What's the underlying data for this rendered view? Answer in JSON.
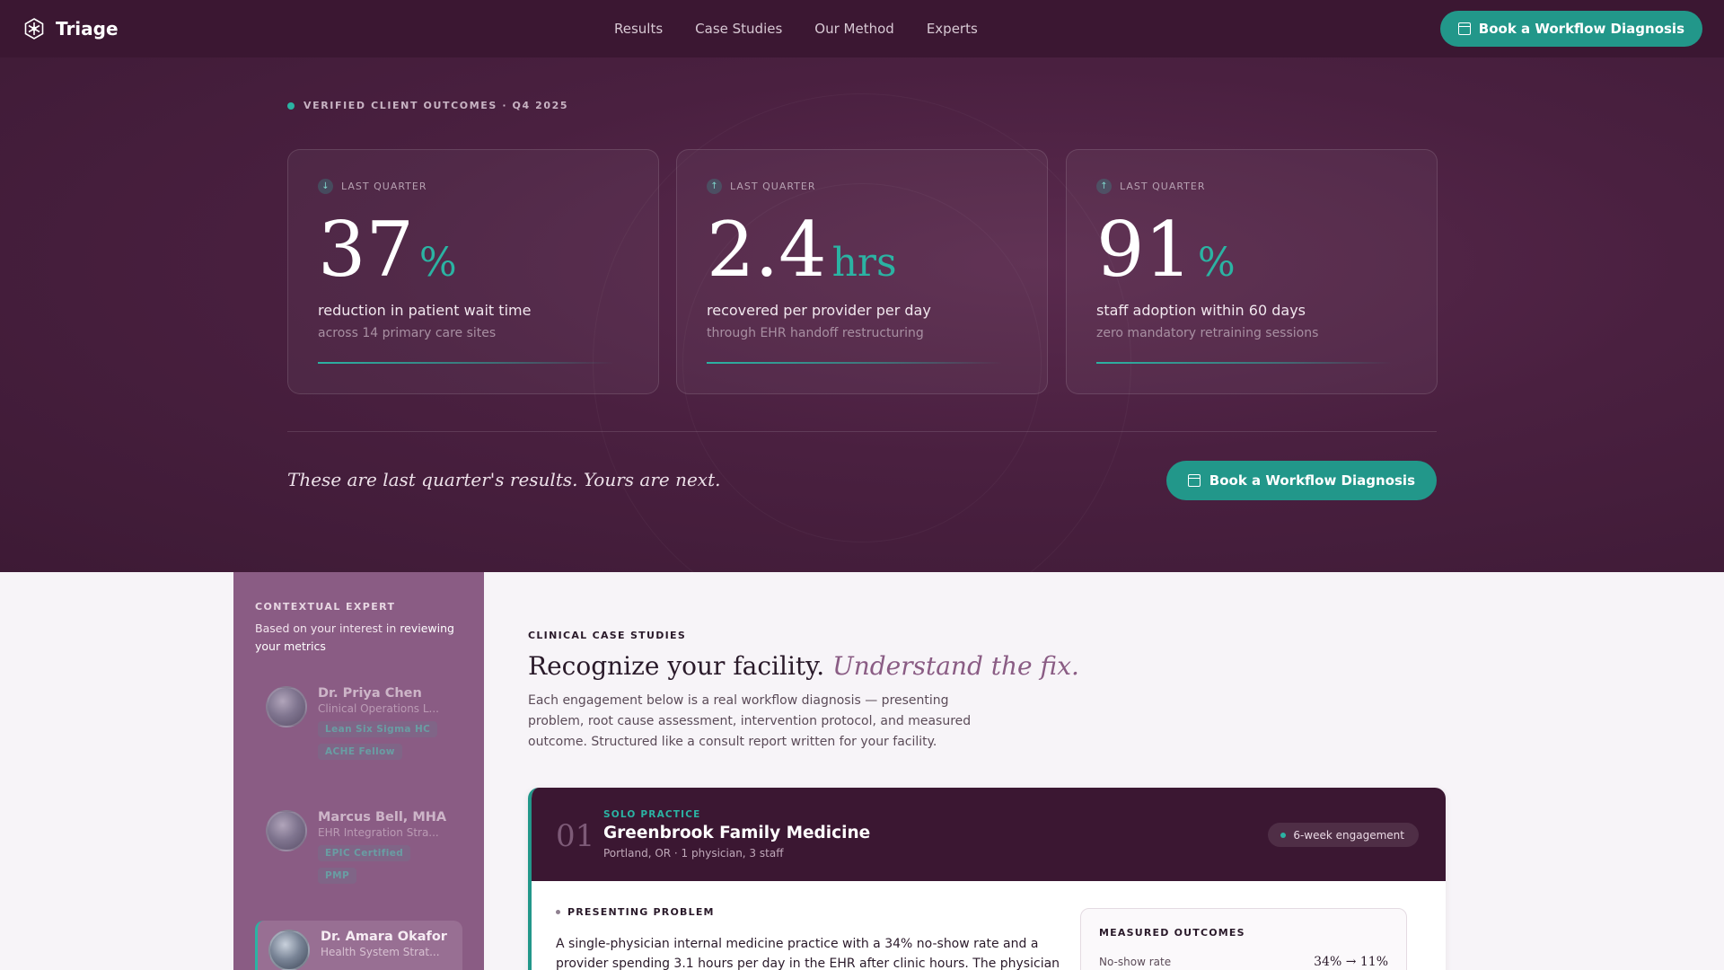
{
  "nav": {
    "brand": "Triage",
    "links": [
      "Results",
      "Case Studies",
      "Our Method",
      "Experts"
    ],
    "cta": "Book a Workflow Diagnosis"
  },
  "hero": {
    "eyebrow": "VERIFIED CLIENT OUTCOMES · Q4 2025",
    "stats": [
      {
        "period": "LAST QUARTER",
        "direction": "down",
        "value": "37",
        "unit": "%",
        "desc": "reduction in patient wait time",
        "sub": "across 14 primary care sites"
      },
      {
        "period": "LAST QUARTER",
        "direction": "up",
        "value": "2.4",
        "unit": "hrs",
        "desc": "recovered per provider per day",
        "sub": "through EHR handoff restructuring"
      },
      {
        "period": "LAST QUARTER",
        "direction": "up",
        "value": "91",
        "unit": "%",
        "desc": "staff adoption within 60 days",
        "sub": "zero mandatory retraining sessions"
      }
    ],
    "tagline": "These are last quarter's results. Yours are next.",
    "cta": "Book a Workflow Diagnosis"
  },
  "sidebar": {
    "label": "CONTEXTUAL EXPERT",
    "context_prefix": "Based on your interest in ",
    "context_highlight": "reviewing your metrics",
    "experts": [
      {
        "name": "Dr. Priya Chen",
        "role": "Clinical Operations L...",
        "badges": [
          "Lean Six Sigma HC",
          "ACHE Fellow"
        ]
      },
      {
        "name": "Marcus Bell, MHA",
        "role": "EHR Integration Stra...",
        "badges": [
          "EPIC Certified",
          "PMP"
        ]
      },
      {
        "name": "Dr. Amara Okafor",
        "role": "Health System Strat...",
        "badges": []
      }
    ]
  },
  "main": {
    "eyebrow": "CLINICAL CASE STUDIES",
    "title": "Recognize your facility.",
    "title_em": "Understand the fix.",
    "body": "Each engagement below is a real workflow diagnosis — presenting problem, root cause assessment, intervention protocol, and measured outcome. Structured like a consult report written for your facility.",
    "case": {
      "number": "01",
      "type": "SOLO PRACTICE",
      "name": "Greenbrook Family Medicine",
      "meta": "Portland, OR · 1 physician, 3 staff",
      "engagement": "6-week engagement",
      "problem_label": "PRESENTING PROBLEM",
      "problem_text": "A single-physician internal medicine practice with a 34% no-show rate and a provider spending 3.1 hours per day in the EHR after clinic hours. The physician",
      "outcomes_label": "MEASURED OUTCOMES",
      "outcome_name": "No-show rate",
      "outcome_value": "34% → 11%"
    }
  },
  "colors": {
    "accent": "#22978a",
    "nav_bg": "#3b1732",
    "sidebar_bg": "#8a5c84"
  }
}
